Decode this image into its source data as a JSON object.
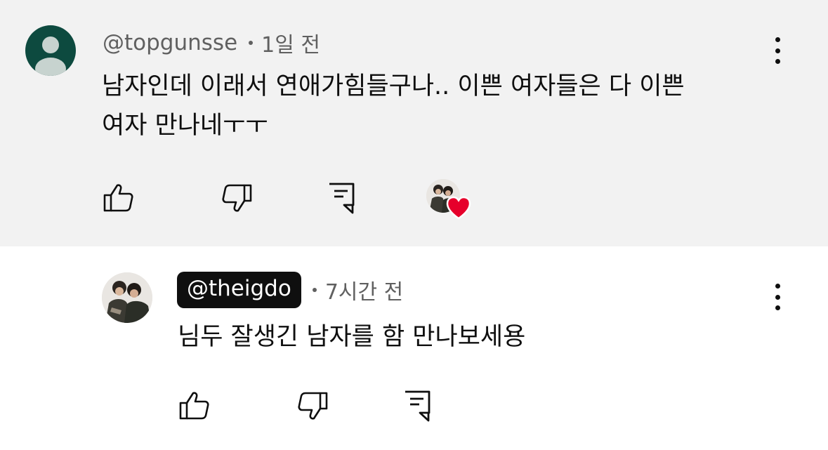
{
  "comments": [
    {
      "handle": "@topgunsse",
      "time": "1일 전",
      "text_line1": "남자인데 이래서 연애가힘들구나.. 이쁜 여자들은 다 이쁜",
      "text_line2": "여자 만나네ㅜㅜ",
      "avatar_icon": "default-person-avatar",
      "creator_heart": true
    },
    {
      "handle": "@theigdo",
      "time": "7시간 전",
      "text_line1": "님두 잘생긴 남자를 함 만나보세용",
      "avatar_icon": "user-photo-avatar",
      "creator_heart": false
    }
  ],
  "colors": {
    "highlight_bg": "#f2f2f2",
    "avatar_default_bg": "#0d4a3f",
    "heart": "#e6002b",
    "secondary_text": "#606060"
  },
  "icons": [
    "thumbs-up-icon",
    "thumbs-down-icon",
    "reply-icon",
    "more-vert-icon",
    "heart-icon"
  ]
}
